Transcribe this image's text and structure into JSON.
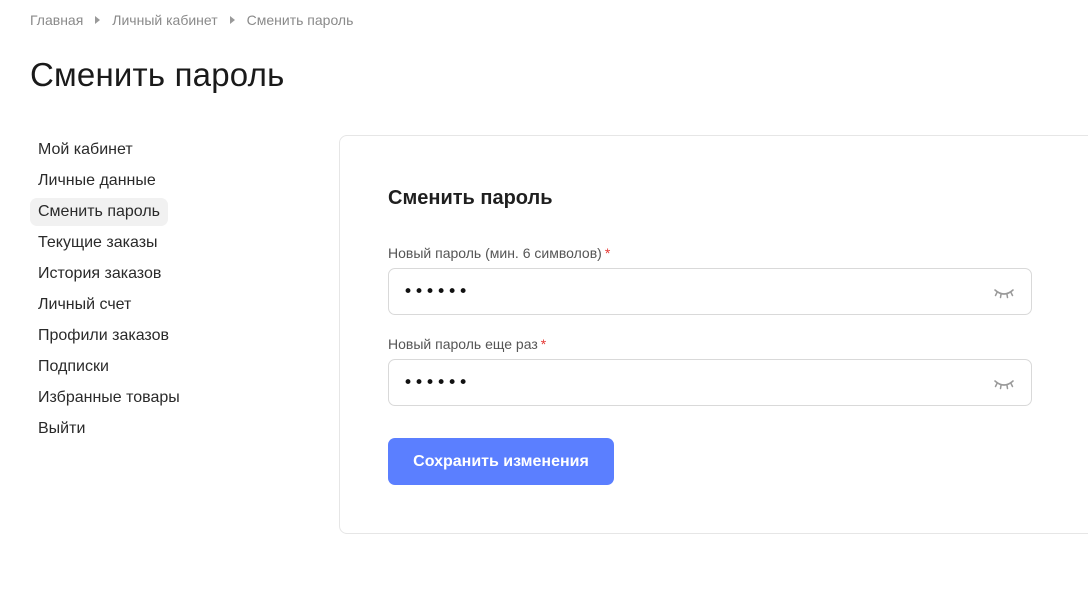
{
  "breadcrumb": {
    "items": [
      "Главная",
      "Личный кабинет",
      "Сменить пароль"
    ]
  },
  "page": {
    "title": "Сменить пароль"
  },
  "sidebar": {
    "items": [
      {
        "label": "Мой кабинет",
        "active": false
      },
      {
        "label": "Личные данные",
        "active": false
      },
      {
        "label": "Сменить пароль",
        "active": true
      },
      {
        "label": "Текущие заказы",
        "active": false
      },
      {
        "label": "История заказов",
        "active": false
      },
      {
        "label": "Личный счет",
        "active": false
      },
      {
        "label": "Профили заказов",
        "active": false
      },
      {
        "label": "Подписки",
        "active": false
      },
      {
        "label": "Избранные товары",
        "active": false
      },
      {
        "label": "Выйти",
        "active": false
      }
    ]
  },
  "form": {
    "title": "Сменить пароль",
    "new_password": {
      "label": "Новый пароль (мин. 6 символов)",
      "required_mark": "*",
      "value": "••••••",
      "icon": "eye-closed-icon"
    },
    "repeat_password": {
      "label": "Новый пароль еще раз",
      "required_mark": "*",
      "value": "••••••",
      "icon": "eye-closed-icon"
    },
    "submit_label": "Сохранить изменения"
  },
  "colors": {
    "accent": "#5b7fff",
    "required": "#e53935",
    "active_bg": "#f1f1f1",
    "border": "#d9d9d9"
  }
}
